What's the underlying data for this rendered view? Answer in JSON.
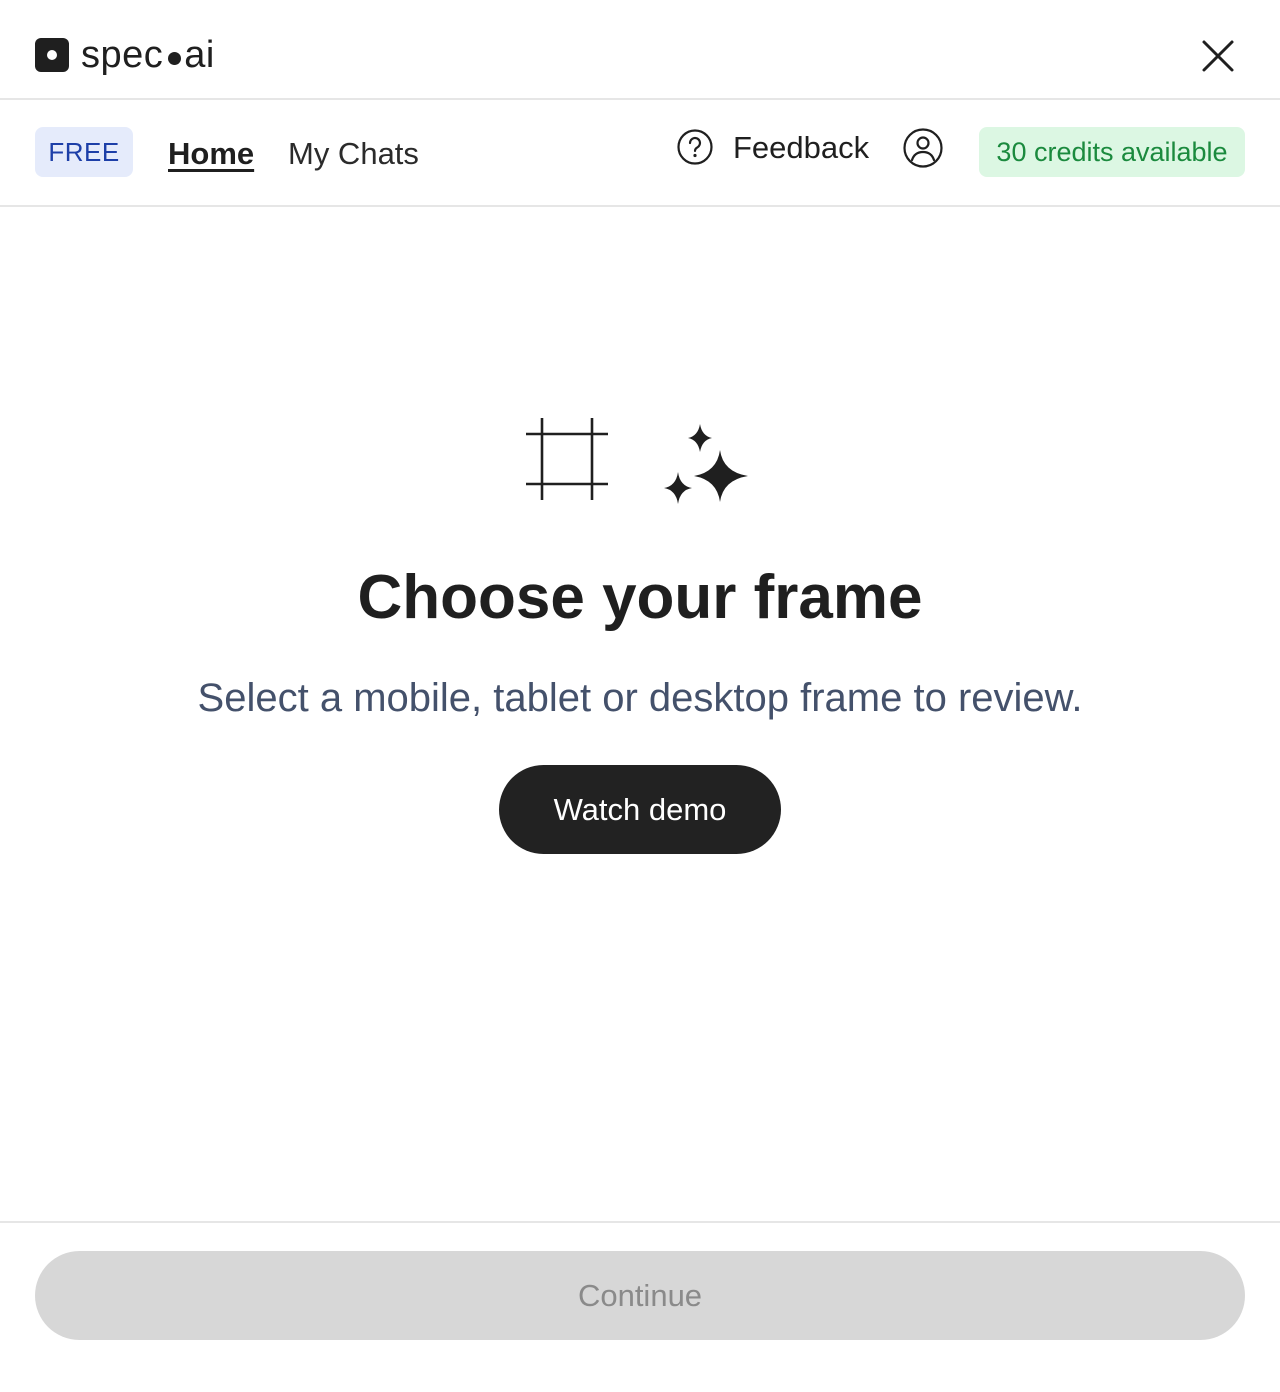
{
  "app": {
    "logo_left": "spec",
    "logo_right": "ai"
  },
  "nav": {
    "plan_badge": "FREE",
    "home_label": "Home",
    "chats_label": "My Chats",
    "feedback_label": "Feedback",
    "credits_label": "30 credits available"
  },
  "main": {
    "title": "Choose your frame",
    "subtitle": "Select a mobile, tablet or desktop frame to review.",
    "watch_demo_label": "Watch demo"
  },
  "footer": {
    "continue_label": "Continue",
    "continue_enabled": false
  },
  "icons": {
    "close": "close-icon",
    "help": "question-circle-icon",
    "user": "user-circle-icon",
    "frame": "frame-crop-icon",
    "sparkle": "sparkles-icon"
  },
  "colors": {
    "plan_badge_bg": "#e5ebfb",
    "plan_badge_text": "#1d3fa8",
    "credits_bg": "#dcf7e3",
    "credits_text": "#1b8a3e",
    "primary_button": "#222222",
    "disabled_button": "#d7d7d7"
  }
}
